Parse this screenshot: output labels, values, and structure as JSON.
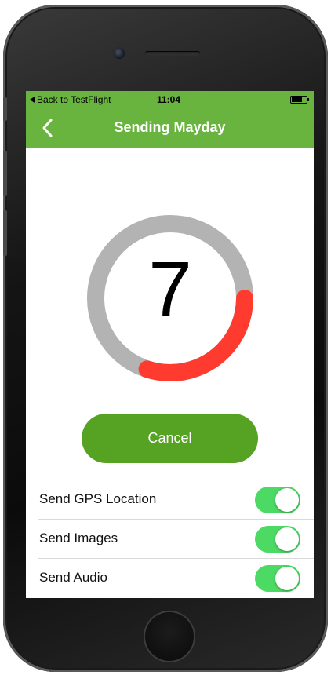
{
  "status_bar": {
    "back_label": "Back to TestFlight",
    "time": "11:04",
    "battery_level": 0.7
  },
  "nav": {
    "title": "Sending Mayday",
    "back_icon": "chevron-left-icon"
  },
  "countdown": {
    "value": "7",
    "progress_fraction": 0.3,
    "track_color": "#b3b3b3",
    "progress_color": "#ff3b30"
  },
  "actions": {
    "cancel_label": "Cancel"
  },
  "options": [
    {
      "label": "Send GPS Location",
      "enabled": true
    },
    {
      "label": "Send Images",
      "enabled": true
    },
    {
      "label": "Send Audio",
      "enabled": true
    }
  ],
  "colors": {
    "brand_green": "#69b43f",
    "button_green": "#56a324",
    "toggle_on": "#4cd964"
  }
}
